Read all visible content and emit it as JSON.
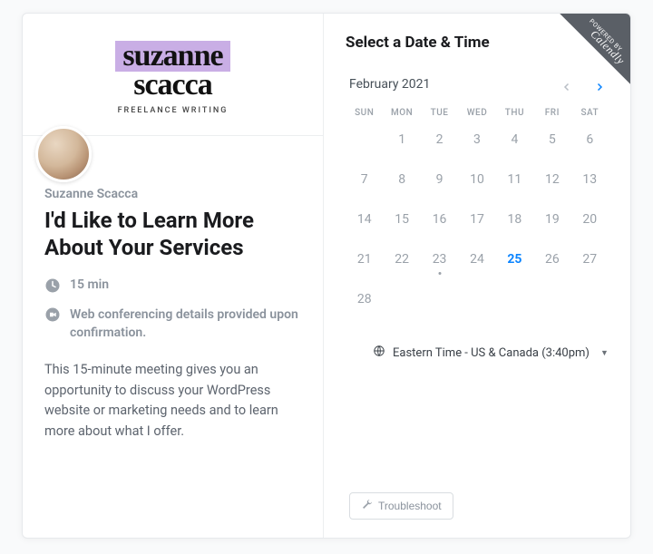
{
  "ribbon": {
    "line1": "POWERED BY",
    "line2": "Calendly"
  },
  "logo": {
    "line1": "suzanne",
    "line2": "scacca",
    "sub": "FREELANCE WRITING"
  },
  "host": "Suzanne Scacca",
  "event_title": "I'd Like to Learn More About Your Services",
  "duration": "15 min",
  "conferencing": "Web conferencing details provided upon confirmation.",
  "description": "This 15-minute meeting gives you an opportunity to discuss your WordPress website or marketing needs and to learn more about what I offer.",
  "right_heading": "Select a Date & Time",
  "month": "February 2021",
  "dow": [
    "SUN",
    "MON",
    "TUE",
    "WED",
    "THU",
    "FRI",
    "SAT"
  ],
  "weeks": [
    [
      "",
      "1",
      "2",
      "3",
      "4",
      "5",
      "6"
    ],
    [
      "7",
      "8",
      "9",
      "10",
      "11",
      "12",
      "13"
    ],
    [
      "14",
      "15",
      "16",
      "17",
      "18",
      "19",
      "20"
    ],
    [
      "21",
      "22",
      "23",
      "24",
      "25",
      "26",
      "27"
    ],
    [
      "28",
      "",
      "",
      "",
      "",
      "",
      ""
    ]
  ],
  "selected_day": "25",
  "dotted_day": "23",
  "timezone": "Eastern Time - US & Canada (3:40pm)",
  "troubleshoot": "Troubleshoot"
}
